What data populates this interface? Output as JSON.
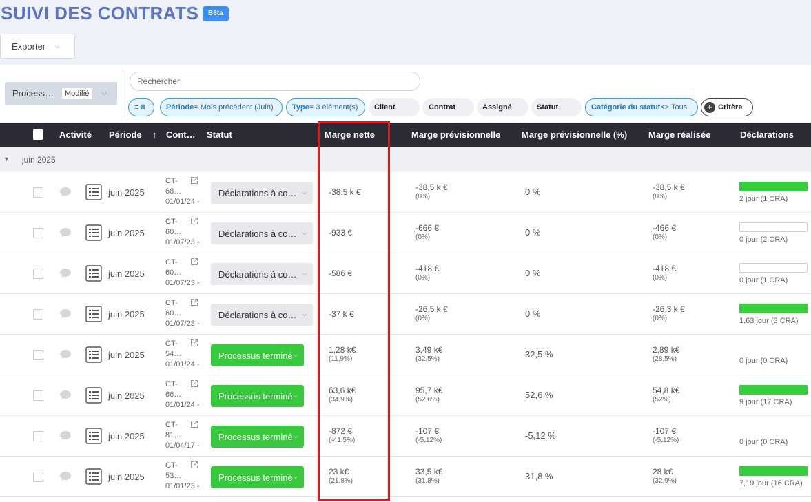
{
  "header": {
    "title": "SUIVI DES CONTRATS",
    "beta": "Bêta",
    "export_label": "Exporter"
  },
  "filters": {
    "process_label": "Process…",
    "process_badge": "Modifié",
    "search_placeholder": "Rechercher",
    "count_chip": "8",
    "periode_key": "Période",
    "periode_val": " = Mois précédent (Juin)",
    "type_key": "Type",
    "type_val": " = 3 élément(s)",
    "client": "Client",
    "contrat": "Contrat",
    "assigne": "Assigné",
    "statut": "Statut",
    "categorie_key": "Catégorie du statut",
    "categorie_val": " <> Tous",
    "critere": "Critère"
  },
  "columns": {
    "activite": "Activité",
    "periode": "Période",
    "sort_arrow": "↑",
    "contrat": "Cont…",
    "statut": "Statut",
    "marge_nette": "Marge nette",
    "marge_prev": "Marge prévisionnelle",
    "marge_prev_pct": "Marge prévisionnelle (%)",
    "marge_realisee": "Marge réalisée",
    "declarations": "Déclarations"
  },
  "group": {
    "label": "juin 2025"
  },
  "rows": [
    {
      "periode": "juin 2025",
      "ct1": "CT-",
      "ct2": "68…",
      "ct3": "01/01/24 -",
      "status": "Déclarations à co…",
      "status_type": "gray",
      "marge_nette": "-38,5 k €",
      "marge_nette_pct": "",
      "mp": "-38,5 k €",
      "mp_pct": "(0%)",
      "mpp": "0 %",
      "mr": "-38,5 k €",
      "mr_pct": "(0%)",
      "progress": 1,
      "decl": "2 jour (1 CRA)"
    },
    {
      "periode": "juin 2025",
      "ct1": "CT-",
      "ct2": "60…",
      "ct3": "01/07/23 -",
      "status": "Déclarations à co…",
      "status_type": "gray",
      "marge_nette": "-933 €",
      "marge_nette_pct": "",
      "mp": "-666 €",
      "mp_pct": "(0%)",
      "mpp": "0 %",
      "mr": "-466 €",
      "mr_pct": "(0%)",
      "progress": 0,
      "decl": "0 jour (2 CRA)"
    },
    {
      "periode": "juin 2025",
      "ct1": "CT-",
      "ct2": "60…",
      "ct3": "01/07/23 -",
      "status": "Déclarations à co…",
      "status_type": "gray",
      "marge_nette": "-586 €",
      "marge_nette_pct": "",
      "mp": "-418 €",
      "mp_pct": "(0%)",
      "mpp": "0 %",
      "mr": "-418 €",
      "mr_pct": "(0%)",
      "progress": 0,
      "decl": "0 jour (1 CRA)"
    },
    {
      "periode": "juin 2025",
      "ct1": "CT-",
      "ct2": "60…",
      "ct3": "01/07/23 -",
      "status": "Déclarations à co…",
      "status_type": "gray",
      "marge_nette": "-37 k €",
      "marge_nette_pct": "",
      "mp": "-26,5 k €",
      "mp_pct": "(0%)",
      "mpp": "0 %",
      "mr": "-26,3 k €",
      "mr_pct": "(0%)",
      "progress": 1,
      "decl": "1,63 jour (3 CRA)"
    },
    {
      "periode": "juin 2025",
      "ct1": "CT-",
      "ct2": "54…",
      "ct3": "01/01/24 -",
      "status": "Processus terminé",
      "status_type": "green",
      "marge_nette": "1,28 k€",
      "marge_nette_pct": "(11,9%)",
      "mp": "3,49 k€",
      "mp_pct": "(32,5%)",
      "mpp": "32,5 %",
      "mr": "2,89 k€",
      "mr_pct": "(28,5%)",
      "progress": null,
      "decl": "0 jour (0 CRA)"
    },
    {
      "periode": "juin 2025",
      "ct1": "CT-",
      "ct2": "66…",
      "ct3": "01/01/24 -",
      "status": "Processus terminé",
      "status_type": "green",
      "marge_nette": "63,6 k€",
      "marge_nette_pct": "(34,9%)",
      "mp": "95,7 k€",
      "mp_pct": "(52,6%)",
      "mpp": "52,6 %",
      "mr": "54,8 k€",
      "mr_pct": "(52%)",
      "progress": 1,
      "decl": "9 jour (17 CRA)"
    },
    {
      "periode": "juin 2025",
      "ct1": "CT-",
      "ct2": "81…",
      "ct3": "01/04/17 -",
      "status": "Processus terminé",
      "status_type": "green",
      "marge_nette": "-872 €",
      "marge_nette_pct": "(-41,5%)",
      "mp": "-107 €",
      "mp_pct": "(-5,12%)",
      "mpp": "-5,12 %",
      "mr": "-107 €",
      "mr_pct": "(-5,12%)",
      "progress": null,
      "decl": "0 jour (0 CRA)"
    },
    {
      "periode": "juin 2025",
      "ct1": "CT-",
      "ct2": "53…",
      "ct3": "01/01/23 -",
      "status": "Processus terminé",
      "status_type": "green",
      "marge_nette": "23 k€",
      "marge_nette_pct": "(21,8%)",
      "mp": "33,5 k€",
      "mp_pct": "(31,8%)",
      "mpp": "31,8 %",
      "mr": "28 k€",
      "mr_pct": "(32,9%)",
      "progress": 1,
      "decl": "7,19 jour (16 CRA)"
    }
  ],
  "colors": {
    "accent": "#5b73c7",
    "green": "#38c93e",
    "header": "#2b2b36",
    "highlight": "#e01818"
  }
}
